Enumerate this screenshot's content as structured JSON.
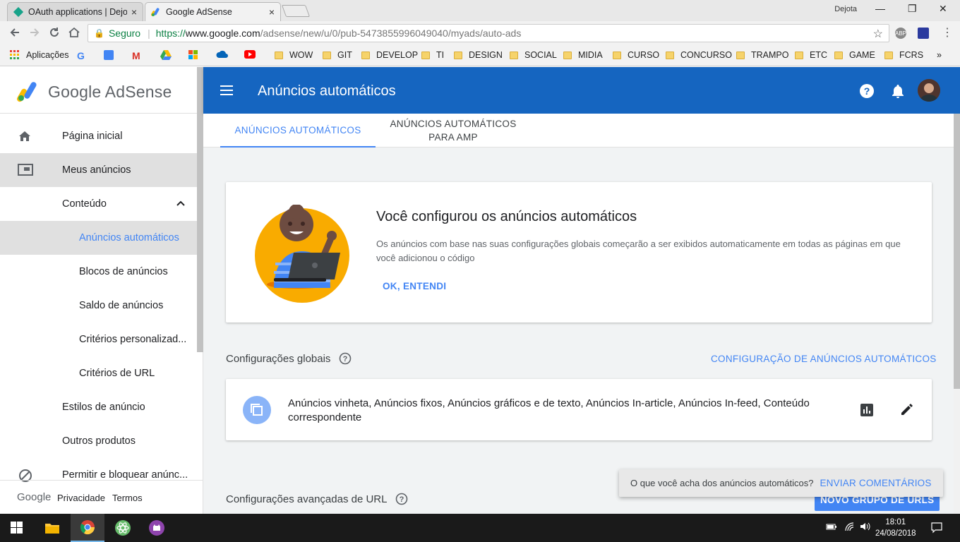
{
  "browser": {
    "tabs": [
      {
        "title": "OAuth applications | Dejo",
        "close": "×"
      },
      {
        "title": "Google AdSense",
        "close": "×"
      }
    ],
    "user": "Dejota",
    "window_controls": {
      "minimize": "—",
      "maximize": "❐",
      "close": "✕"
    },
    "secure_label": "Seguro",
    "url_proto": "https://",
    "url_host": "www.google.com",
    "url_path": "/adsense/new/u/0/pub-5473855996049040/myads/auto-ads",
    "abp": "ABP"
  },
  "bookmarks": {
    "apps_label": "Aplicações",
    "folders": [
      "WOW",
      "GIT",
      "DEVELOP",
      "TI",
      "DESIGN",
      "SOCIAL",
      "MIDIA",
      "CURSO",
      "CONCURSO",
      "TRAMPO",
      "ETC",
      "GAME",
      "FCRS"
    ],
    "more": "»"
  },
  "sidebar": {
    "brand": "Google AdSense",
    "items": [
      {
        "label": "Página inicial"
      },
      {
        "label": "Meus anúncios"
      },
      {
        "label": "Conteúdo"
      },
      {
        "label": "Anúncios automáticos"
      },
      {
        "label": "Blocos de anúncios"
      },
      {
        "label": "Saldo de anúncios"
      },
      {
        "label": "Critérios personalizad..."
      },
      {
        "label": "Critérios de URL"
      },
      {
        "label": "Estilos de anúncio"
      },
      {
        "label": "Outros produtos"
      },
      {
        "label": "Permitir e bloquear anúnc..."
      }
    ],
    "footer": {
      "google": "Google",
      "privacy": "Privacidade",
      "terms": "Termos"
    }
  },
  "header": {
    "title": "Anúncios automáticos"
  },
  "page_tabs": [
    {
      "label": "ANÚNCIOS AUTOMÁTICOS"
    },
    {
      "line1": "ANÚNCIOS AUTOMÁTICOS",
      "line2": "PARA AMP"
    }
  ],
  "hero": {
    "title": "Você configurou os anúncios automáticos",
    "description": "Os anúncios com base nas suas configurações globais começarão a ser exibidos automaticamente em todas as páginas em que você adicionou o código",
    "button": "OK, ENTENDI"
  },
  "global_settings": {
    "title": "Configurações globais",
    "link": "CONFIGURAÇÃO DE ANÚNCIOS AUTOMÁTICOS",
    "summary": "Anúncios vinheta, Anúncios fixos, Anúncios gráficos e de texto, Anúncios In-article, Anúncios In-feed, Conteúdo correspondente"
  },
  "advanced": {
    "title": "Configurações avançadas de URL",
    "button": "NOVO GRUPO DE URLS"
  },
  "snackbar": {
    "text": "O que você acha dos anúncios automáticos?",
    "button": "ENVIAR COMENTÁRIOS"
  },
  "taskbar": {
    "time": "18:01",
    "date": "24/08/2018"
  },
  "colors": {
    "primary": "#1565c0",
    "accent": "#4285f4",
    "selected": "#e0e0e0"
  }
}
